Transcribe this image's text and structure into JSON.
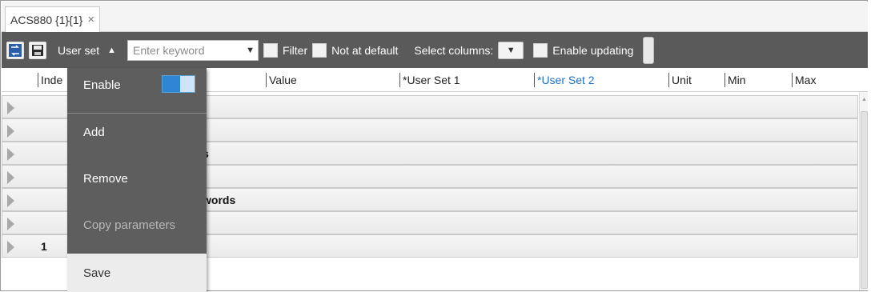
{
  "tab": {
    "title": "ACS880 {1}{1}",
    "close_glyph": "×"
  },
  "toolbar": {
    "userset_label": "User set",
    "userset_caret": "▲",
    "search_placeholder": "Enter keyword",
    "dropdown_glyph": "▼",
    "filter_label": "Filter",
    "not_at_default_label": "Not at default",
    "select_columns_label": "Select columns:",
    "enable_updating_label": "Enable updating"
  },
  "columns": [
    "Inde",
    "Value",
    "*User Set 1",
    "*User Set 2",
    "Unit",
    "Min",
    "Max"
  ],
  "rows": [
    {
      "label": "",
      "num": ""
    },
    {
      "label": "",
      "num": ""
    },
    {
      "label": "s",
      "num": ""
    },
    {
      "label": "",
      "num": ""
    },
    {
      "label": "words",
      "num": ""
    },
    {
      "label": "",
      "num": ""
    },
    {
      "label": "",
      "num": "1"
    }
  ],
  "menu": {
    "enable_label": "Enable",
    "enable_on": true,
    "add_label": "Add",
    "remove_label": "Remove",
    "copy_label": "Copy parameters",
    "save_label": "Save"
  },
  "colors": {
    "toolbar_bg": "#5a5a5a",
    "menu_bg": "#5e5e5e",
    "highlight_column": "#1f6fc6",
    "toggle_on": "#2f86d4"
  }
}
